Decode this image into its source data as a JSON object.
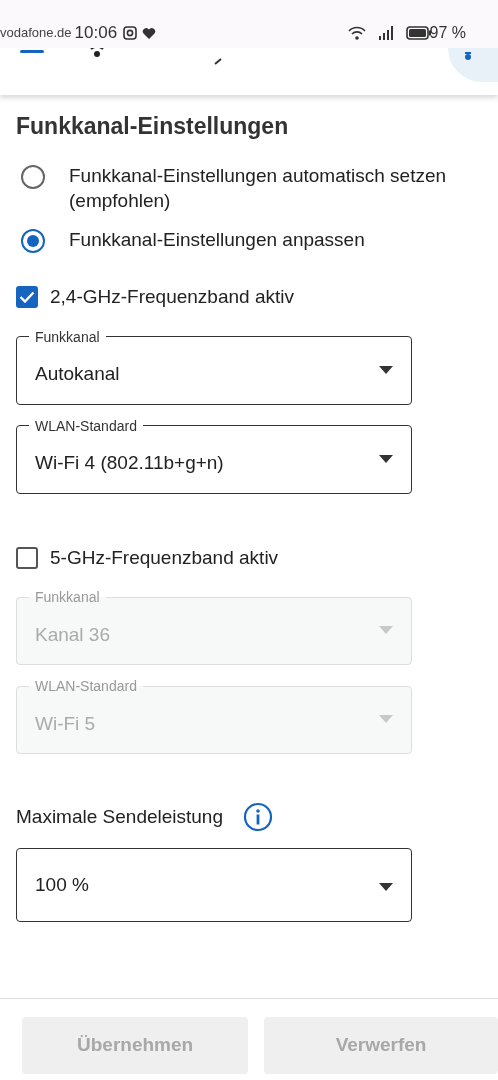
{
  "status_bar": {
    "carrier": "vodafone.de",
    "time": "10:06",
    "battery": "97 %"
  },
  "title": "Funkkanal-Einstellungen",
  "mode_options": [
    {
      "label": "Funkkanal-Einstellungen automatisch setzen (empfohlen)",
      "selected": false
    },
    {
      "label": "Funkkanal-Einstellungen anpassen",
      "selected": true
    }
  ],
  "bands": [
    {
      "label": "2,4-GHz-Frequenzband aktiv",
      "checked": true,
      "fields": [
        {
          "label": "Funkkanal",
          "value": "Autokanal"
        },
        {
          "label": "WLAN-Standard",
          "value": "Wi-Fi 4 (802.11b+g+n)"
        }
      ]
    },
    {
      "label": "5-GHz-Frequenzband aktiv",
      "checked": false,
      "fields": [
        {
          "label": "Funkkanal",
          "value": "Kanal 36"
        },
        {
          "label": "WLAN-Standard",
          "value": "Wi-Fi 5"
        }
      ]
    }
  ],
  "power": {
    "label": "Maximale Sendeleistung",
    "value": "100 %"
  },
  "buttons": [
    {
      "label": "Übernehmen",
      "disabled": true
    },
    {
      "label": "Verwerfen",
      "disabled": true
    }
  ]
}
